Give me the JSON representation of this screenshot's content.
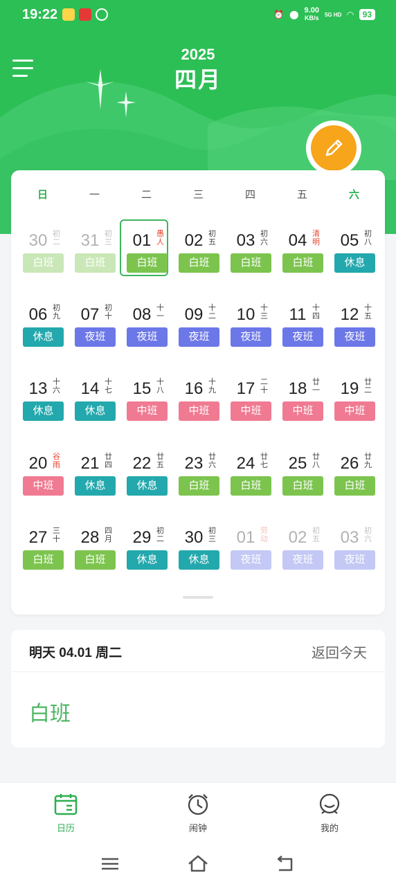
{
  "status": {
    "time": "19:22",
    "net_speed": "9.00",
    "net_unit": "KB/s",
    "signal": "5G HD",
    "battery": "93"
  },
  "header": {
    "year": "2025",
    "month": "四月"
  },
  "weekdays": [
    "日",
    "一",
    "二",
    "三",
    "四",
    "五",
    "六"
  ],
  "shift_colors": {
    "白班": "#7cc44e",
    "休息": "#23a8ad",
    "夜班": "#6c77e8",
    "中班": "#f07a92"
  },
  "calendar": [
    {
      "day": "30",
      "lunar": "初二",
      "lunar_red": false,
      "shift": "白班",
      "dim": true
    },
    {
      "day": "31",
      "lunar": "初三",
      "lunar_red": false,
      "shift": "白班",
      "dim": true
    },
    {
      "day": "01",
      "lunar": "愚人",
      "lunar_red": true,
      "shift": "白班",
      "selected": true
    },
    {
      "day": "02",
      "lunar": "初五",
      "lunar_red": false,
      "shift": "白班"
    },
    {
      "day": "03",
      "lunar": "初六",
      "lunar_red": false,
      "shift": "白班"
    },
    {
      "day": "04",
      "lunar": "清明",
      "lunar_red": true,
      "shift": "白班"
    },
    {
      "day": "05",
      "lunar": "初八",
      "lunar_red": false,
      "shift": "休息"
    },
    {
      "day": "06",
      "lunar": "初九",
      "lunar_red": false,
      "shift": "休息"
    },
    {
      "day": "07",
      "lunar": "初十",
      "lunar_red": false,
      "shift": "夜班"
    },
    {
      "day": "08",
      "lunar": "十一",
      "lunar_red": false,
      "shift": "夜班"
    },
    {
      "day": "09",
      "lunar": "十二",
      "lunar_red": false,
      "shift": "夜班"
    },
    {
      "day": "10",
      "lunar": "十三",
      "lunar_red": false,
      "shift": "夜班"
    },
    {
      "day": "11",
      "lunar": "十四",
      "lunar_red": false,
      "shift": "夜班"
    },
    {
      "day": "12",
      "lunar": "十五",
      "lunar_red": false,
      "shift": "夜班"
    },
    {
      "day": "13",
      "lunar": "十六",
      "lunar_red": false,
      "shift": "休息"
    },
    {
      "day": "14",
      "lunar": "十七",
      "lunar_red": false,
      "shift": "休息"
    },
    {
      "day": "15",
      "lunar": "十八",
      "lunar_red": false,
      "shift": "中班"
    },
    {
      "day": "16",
      "lunar": "十九",
      "lunar_red": false,
      "shift": "中班"
    },
    {
      "day": "17",
      "lunar": "二十",
      "lunar_red": false,
      "shift": "中班"
    },
    {
      "day": "18",
      "lunar": "廿一",
      "lunar_red": false,
      "shift": "中班"
    },
    {
      "day": "19",
      "lunar": "廿二",
      "lunar_red": false,
      "shift": "中班"
    },
    {
      "day": "20",
      "lunar": "谷雨",
      "lunar_red": true,
      "shift": "中班"
    },
    {
      "day": "21",
      "lunar": "廿四",
      "lunar_red": false,
      "shift": "休息"
    },
    {
      "day": "22",
      "lunar": "廿五",
      "lunar_red": false,
      "shift": "休息"
    },
    {
      "day": "23",
      "lunar": "廿六",
      "lunar_red": false,
      "shift": "白班"
    },
    {
      "day": "24",
      "lunar": "廿七",
      "lunar_red": false,
      "shift": "白班"
    },
    {
      "day": "25",
      "lunar": "廿八",
      "lunar_red": false,
      "shift": "白班"
    },
    {
      "day": "26",
      "lunar": "廿九",
      "lunar_red": false,
      "shift": "白班"
    },
    {
      "day": "27",
      "lunar": "三十",
      "lunar_red": false,
      "shift": "白班"
    },
    {
      "day": "28",
      "lunar": "四月",
      "lunar_red": false,
      "shift": "白班"
    },
    {
      "day": "29",
      "lunar": "初二",
      "lunar_red": false,
      "shift": "休息"
    },
    {
      "day": "30",
      "lunar": "初三",
      "lunar_red": false,
      "shift": "休息"
    },
    {
      "day": "01",
      "lunar": "劳动",
      "lunar_red": true,
      "shift": "夜班",
      "dim": true
    },
    {
      "day": "02",
      "lunar": "初五",
      "lunar_red": false,
      "shift": "夜班",
      "dim": true
    },
    {
      "day": "03",
      "lunar": "初六",
      "lunar_red": false,
      "shift": "夜班",
      "dim": true
    }
  ],
  "detail": {
    "date_label": "明天 04.01 周二",
    "back_today": "返回今天",
    "shift": "白班"
  },
  "tabs": [
    {
      "label": "日历",
      "icon": "calendar-icon",
      "active": true
    },
    {
      "label": "闹钟",
      "icon": "alarm-clock-icon",
      "active": false
    },
    {
      "label": "我的",
      "icon": "profile-icon",
      "active": false
    }
  ]
}
